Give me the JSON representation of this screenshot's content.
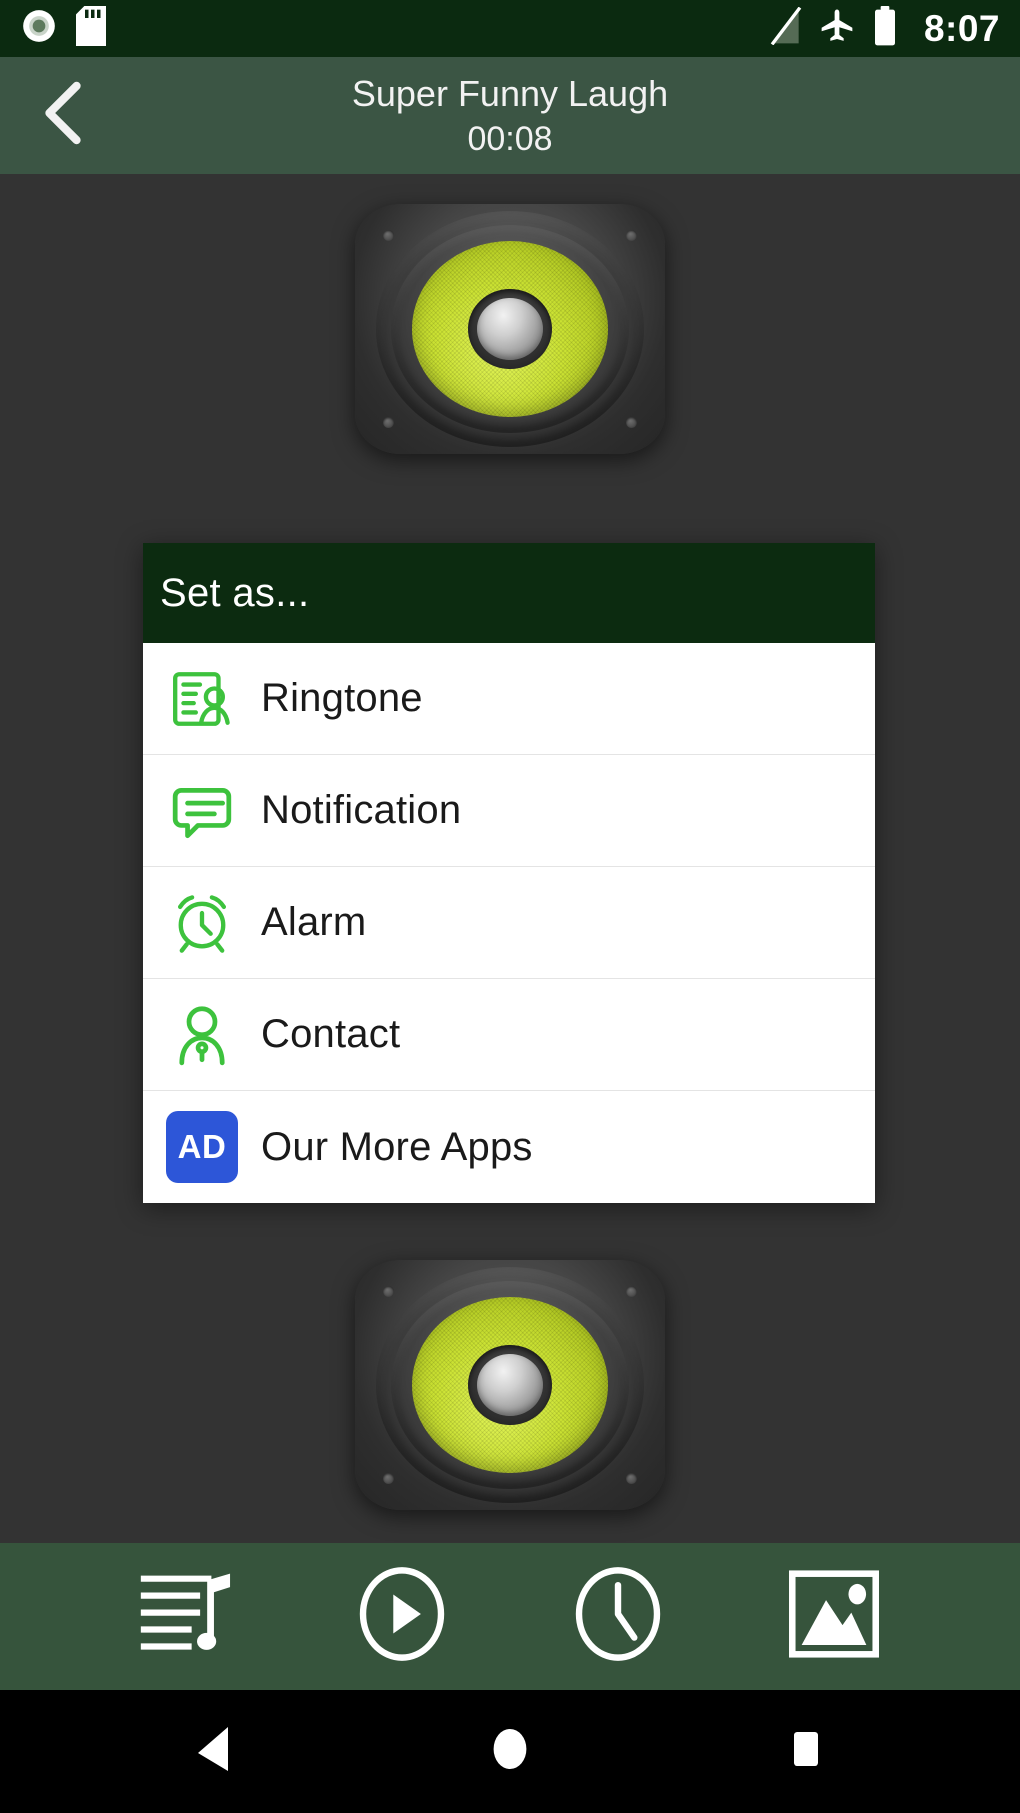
{
  "status_bar": {
    "background": "#0B2A10",
    "time": "8:07",
    "left_icons": [
      {
        "name": "record-circle-icon",
        "label": "recording"
      },
      {
        "name": "sd-card-icon",
        "label": "sd card"
      }
    ],
    "right_icons": [
      {
        "name": "no-signal-icon",
        "label": "no signal"
      },
      {
        "name": "airplane-mode-icon",
        "label": "airplane mode"
      },
      {
        "name": "battery-icon",
        "label": "battery full"
      }
    ]
  },
  "app_bar": {
    "background": "#3B5544",
    "back_label": "Back",
    "title": "Super Funny Laugh",
    "duration": "00:08"
  },
  "content": {
    "background": "#333333",
    "speaker_top": {
      "name": "speaker-image-top",
      "label": "Loudspeaker"
    },
    "speaker_bottom": {
      "name": "speaker-image-bottom",
      "label": "Loudspeaker"
    },
    "cone_color": "#CBE233"
  },
  "dialog": {
    "header_background": "#0C2B10",
    "title": "Set as...",
    "accent_color": "#3DC23D",
    "ad_badge_color": "#2D56D8",
    "items": [
      {
        "icon": "contact-card-icon",
        "label": "Ringtone"
      },
      {
        "icon": "speech-bubble-icon",
        "label": "Notification"
      },
      {
        "icon": "alarm-clock-icon",
        "label": "Alarm"
      },
      {
        "icon": "person-icon",
        "label": "Contact"
      },
      {
        "icon": "ad-badge-icon",
        "label": "Our More Apps",
        "badge_text": "AD"
      }
    ]
  },
  "toolbar": {
    "background": "#36543C",
    "items": [
      {
        "icon": "music-list-icon",
        "label": "Playlist"
      },
      {
        "icon": "play-circle-icon",
        "label": "Play"
      },
      {
        "icon": "clock-icon",
        "label": "Timer"
      },
      {
        "icon": "image-icon",
        "label": "Gallery"
      }
    ]
  },
  "nav_bar": {
    "background": "#000000",
    "items": [
      {
        "icon": "back-triangle-icon",
        "label": "Back"
      },
      {
        "icon": "home-circle-icon",
        "label": "Home"
      },
      {
        "icon": "recents-square-icon",
        "label": "Recents"
      }
    ]
  }
}
